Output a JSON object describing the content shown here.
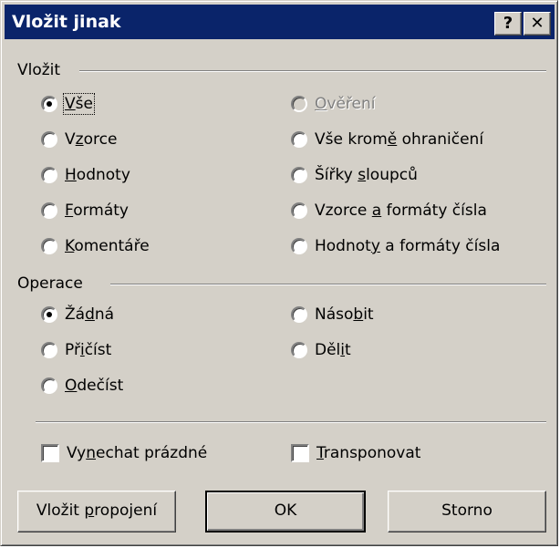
{
  "window": {
    "title": "Vložit jinak",
    "help_label": "?",
    "close_label": "✕"
  },
  "paste_group": {
    "label": "Vložit",
    "options": [
      {
        "pre": "",
        "u": "V",
        "post": "še",
        "selected": true,
        "enabled": true
      },
      {
        "pre": "",
        "u": "O",
        "post": "věření",
        "selected": false,
        "enabled": false
      },
      {
        "pre": "V",
        "u": "z",
        "post": "orce",
        "selected": false,
        "enabled": true
      },
      {
        "pre": "Vše krom",
        "u": "ě",
        "post": " ohraničení",
        "selected": false,
        "enabled": true
      },
      {
        "pre": "",
        "u": "H",
        "post": "odnoty",
        "selected": false,
        "enabled": true
      },
      {
        "pre": "Šířky ",
        "u": "s",
        "post": "loupců",
        "selected": false,
        "enabled": true
      },
      {
        "pre": "",
        "u": "F",
        "post": "ormáty",
        "selected": false,
        "enabled": true
      },
      {
        "pre": "Vzorce ",
        "u": "a",
        "post": " formáty čísla",
        "selected": false,
        "enabled": true
      },
      {
        "pre": "",
        "u": "K",
        "post": "omentáře",
        "selected": false,
        "enabled": true
      },
      {
        "pre": "Hodnot",
        "u": "y",
        "post": " a formáty čísla",
        "selected": false,
        "enabled": true
      }
    ]
  },
  "operation_group": {
    "label": "Operace",
    "options": [
      {
        "pre": "Žá",
        "u": "d",
        "post": "ná",
        "selected": true
      },
      {
        "pre": "Náso",
        "u": "b",
        "post": "it",
        "selected": false
      },
      {
        "pre": "Př",
        "u": "i",
        "post": "číst",
        "selected": false
      },
      {
        "pre": "Děl",
        "u": "i",
        "post": "t",
        "selected": false
      },
      {
        "pre": "",
        "u": "O",
        "post": "dečíst",
        "selected": false
      }
    ]
  },
  "checkboxes": [
    {
      "pre": "Vy",
      "u": "n",
      "post": "echat prázdné",
      "checked": false
    },
    {
      "pre": "",
      "u": "T",
      "post": "ransponovat",
      "checked": false
    }
  ],
  "buttons": {
    "paste_link": {
      "pre": "Vložit ",
      "u": "p",
      "post": "ropojení"
    },
    "ok": "OK",
    "cancel": "Storno"
  }
}
